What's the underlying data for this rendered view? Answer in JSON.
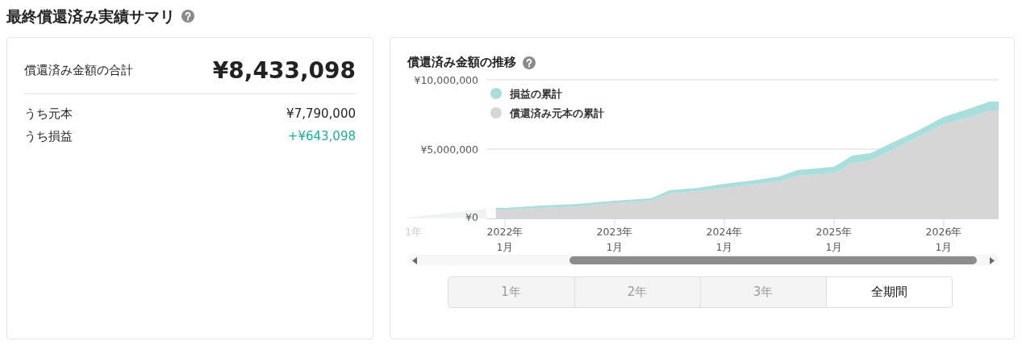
{
  "page_title": "最終償還済み実績サマリ",
  "summary": {
    "total_label": "償還済み金額の合計",
    "total_value": "¥8,433,098",
    "rows": [
      {
        "label": "うち元本",
        "value": "¥7,790,000",
        "kind": "plain"
      },
      {
        "label": "うち損益",
        "value": "+¥643,098",
        "kind": "gain"
      }
    ]
  },
  "chart_panel": {
    "title": "償還済み金額の推移",
    "chart_data": {
      "type": "area",
      "stacked": true,
      "x": [
        "2021-12",
        "2022-01",
        "2022-05",
        "2022-09",
        "2023-01",
        "2023-05",
        "2023-07",
        "2023-10",
        "2024-01",
        "2024-04",
        "2024-07",
        "2024-09",
        "2025-01",
        "2025-03",
        "2025-05",
        "2025-07",
        "2025-10",
        "2026-01",
        "2026-04",
        "2026-06",
        "2026-07"
      ],
      "series": [
        {
          "name": "償還済み元本の累計",
          "color": "#d6d6d6",
          "values": [
            600000,
            620000,
            760000,
            870000,
            1100000,
            1280000,
            1800000,
            1980000,
            2200000,
            2440000,
            2670000,
            3080000,
            3260000,
            4000000,
            4190000,
            4830000,
            5810000,
            6800000,
            7330000,
            7790000,
            7790000
          ]
        },
        {
          "name": "損益の累計",
          "color": "#a8dedb",
          "values": [
            160000,
            140000,
            170000,
            180000,
            180000,
            170000,
            230000,
            220000,
            300000,
            290000,
            350000,
            410000,
            460000,
            530000,
            520000,
            520000,
            470000,
            530000,
            640000,
            640000,
            640000
          ]
        }
      ],
      "ylim": [
        0,
        10000000
      ],
      "xlim": [
        "2021-11",
        "2026-07"
      ],
      "legend": true,
      "yticks": [
        {
          "value": 0,
          "label": "¥0"
        },
        {
          "value": 5000000,
          "label": "¥5,000,000"
        },
        {
          "value": 10000000,
          "label": "¥10,000,000"
        }
      ],
      "xticks": [
        {
          "value": "2022-01",
          "label": "2022年\n1月"
        },
        {
          "value": "2023-01",
          "label": "2023年\n1月"
        },
        {
          "value": "2024-01",
          "label": "2024年\n1月"
        },
        {
          "value": "2025-01",
          "label": "2025年\n1月"
        },
        {
          "value": "2026-01",
          "label": "2026年\n1月"
        }
      ]
    },
    "cut_tick_label": "1年"
  },
  "range_tabs": [
    {
      "label": "1年",
      "selected": false
    },
    {
      "label": "2年",
      "selected": false
    },
    {
      "label": "3年",
      "selected": false
    },
    {
      "label": "全期間",
      "selected": true
    }
  ]
}
